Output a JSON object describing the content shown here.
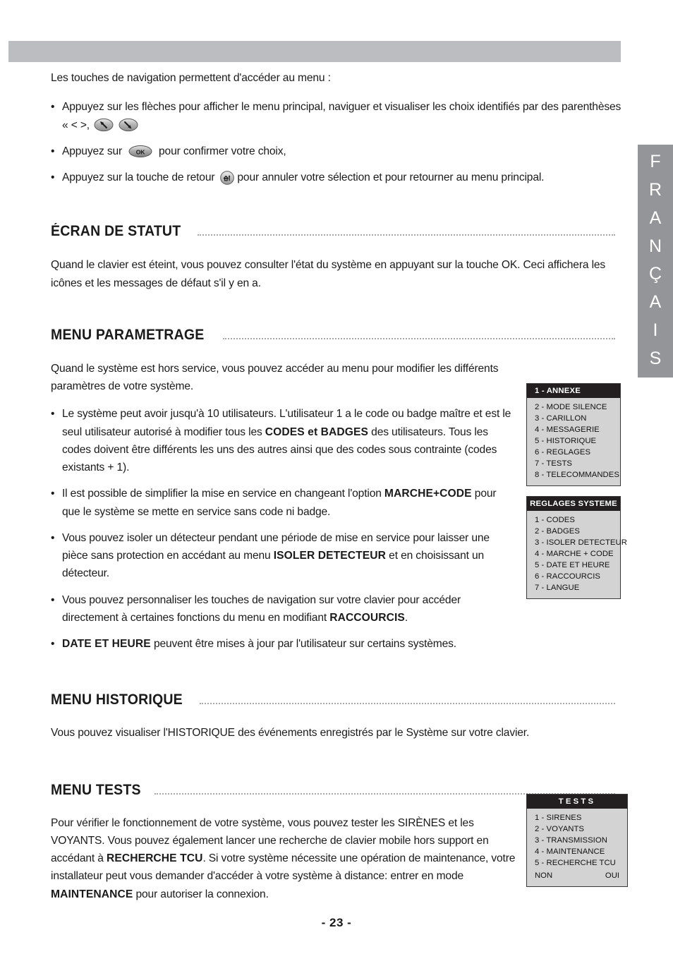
{
  "page": {
    "number_label": "- 23 -",
    "language_tab": [
      "F",
      "R",
      "A",
      "N",
      "Ç",
      "A",
      "I",
      "S"
    ],
    "accent_bar_color": "#bcbdc0",
    "tab_color": "#939598",
    "lcd_body_color": "#d3d3d3",
    "lcd_header_color": "#231f20"
  },
  "intro": {
    "lead": "Les touches de navigation permettent d'accéder au menu :",
    "bullets": [
      {
        "before": "Appuyez sur les flèches pour afficher le menu principal, naviguer et visualiser les choix identifiés par des parenthèses « < >,",
        "icons": [
          "arrow-up-left-key-icon",
          "arrow-down-right-key-icon"
        ],
        "after": ""
      },
      {
        "before": "Appuyez sur",
        "icons": [
          "ok-key-icon"
        ],
        "after": "pour confirmer votre choix,"
      },
      {
        "before": "Appuyez sur la touche de retour",
        "icons": [
          "return-key-icon"
        ],
        "after": "pour annuler votre sélection et pour retourner au menu principal."
      }
    ]
  },
  "sections": [
    {
      "id": "ecran-de-statut",
      "title": "ÉCRAN DE STATUT",
      "paragraph": "Quand le clavier est éteint, vous pouvez consulter l'état du système en appuyant sur la touche OK. Ceci affichera les icônes et les messages de défaut s'il y en a."
    },
    {
      "id": "menu-parametrage",
      "title": "MENU PARAMETRAGE",
      "paragraph": "Quand le système est hors service, vous pouvez accéder au menu pour modifier les différents paramètres de votre système."
    },
    {
      "id": "menu-historique",
      "title": "MENU HISTORIQUE",
      "paragraph": "Vous pouvez visualiser l'HISTORIQUE des événements enregistrés par le Système sur votre clavier."
    },
    {
      "id": "menu-tests",
      "title": "MENU TESTS",
      "paragraph": ""
    }
  ],
  "parametrage_bullets": [
    {
      "parts": [
        {
          "text": "Le système peut avoir jusqu'à 10 utilisateurs. L'utilisateur 1 a le code ou badge maître et est le seul utilisateur autorisé à modifier tous les ",
          "bold": false
        },
        {
          "text": "CODES et BADGES",
          "bold": true
        },
        {
          "text": " des utilisateurs. Tous les codes doivent être différents les uns des autres ainsi que des codes sous contrainte (codes existants + 1).",
          "bold": false
        }
      ]
    },
    {
      "parts": [
        {
          "text": "Il est possible de simplifier la mise en service en changeant l'option ",
          "bold": false
        },
        {
          "text": "MARCHE+CODE",
          "bold": true
        },
        {
          "text": " pour que le système se mette en service sans code ni badge.",
          "bold": false
        }
      ]
    },
    {
      "parts": [
        {
          "text": "Vous pouvez isoler un détecteur pendant une période de mise en service pour laisser une pièce sans protection en accédant au menu ",
          "bold": false
        },
        {
          "text": "ISOLER DETECTEUR",
          "bold": true
        },
        {
          "text": " et en choisissant un détecteur.",
          "bold": false
        }
      ]
    },
    {
      "parts": [
        {
          "text": "Vous pouvez personnaliser les touches de navigation sur votre clavier pour accéder directement à certaines fonctions du menu en modifiant ",
          "bold": false
        },
        {
          "text": "RACCOURCIS",
          "bold": true
        },
        {
          "text": ".",
          "bold": false
        }
      ]
    },
    {
      "parts": [
        {
          "text": "DATE ET HEURE",
          "bold": true
        },
        {
          "text": " peuvent être mises à jour par l'utilisateur sur certains systèmes.",
          "bold": false
        }
      ]
    }
  ],
  "tests_paragraph": {
    "line1": "Pour vérifier le fonctionnement de votre système, vous pouvez tester les SIRÈNES et les VOYANTS. Vous pouvez également lancer une recherche de clavier mobile hors support en accédant à ",
    "bold1": "RECHERCHE TCU",
    "line2": ". Si votre système nécessite une opération de maintenance, votre installateur peut vous demander d'accéder à votre système à distance: entrer en mode ",
    "bold2": "MAINTENANCE",
    "line3": " pour autoriser la connexion."
  },
  "lcd_annexe": {
    "header": "1 - ANNEXE",
    "items": [
      "2 - MODE SILENCE",
      "3 - CARILLON",
      "4 - MESSAGERIE",
      "5 - HISTORIQUE",
      "6 - REGLAGES",
      "7 - TESTS",
      "8 - TELECOMMANDES"
    ]
  },
  "lcd_reglages": {
    "header": "REGLAGES SYSTEME",
    "items": [
      "1 - CODES",
      "2 - BADGES",
      "3 - ISOLER DETECTEUR",
      "4 - MARCHE + CODE",
      "5 - DATE ET HEURE",
      "6 - RACCOURCIS",
      "7 - LANGUE"
    ]
  },
  "lcd_tests": {
    "header": "TESTS",
    "items": [
      "1 - SIRENES",
      "2 - VOYANTS",
      "3 - TRANSMISSION",
      "4 - MAINTENANCE",
      "5 - RECHERCHE TCU"
    ],
    "footer_left": "NON",
    "footer_right": "OUI"
  }
}
